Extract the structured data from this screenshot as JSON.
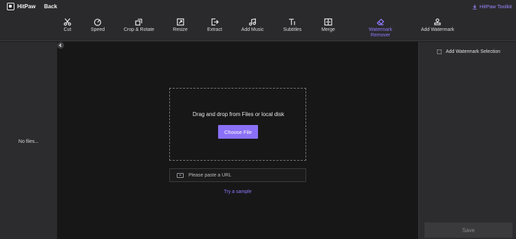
{
  "app": {
    "name": "HitPaw",
    "back_label": "Back",
    "toolkit_label": "HitPaw Toolkit"
  },
  "toolbar": {
    "tools": [
      {
        "label": "Cut",
        "icon": "scissors-icon"
      },
      {
        "label": "Speed",
        "icon": "speedometer-icon"
      },
      {
        "label": "Crop & Rotate",
        "icon": "crop-rotate-icon"
      },
      {
        "label": "Resize",
        "icon": "resize-icon"
      },
      {
        "label": "Extract",
        "icon": "extract-icon"
      },
      {
        "label": "Add Music",
        "icon": "music-note-icon"
      },
      {
        "label": "Subtitles",
        "icon": "text-icon"
      },
      {
        "label": "Merge",
        "icon": "merge-icon"
      },
      {
        "label": "Watermark\nRemover",
        "icon": "eraser-icon",
        "active": true
      },
      {
        "label": "Add Watermark",
        "icon": "stamp-icon"
      }
    ]
  },
  "left_panel": {
    "empty_text": "No files..."
  },
  "upload": {
    "drop_text": "Drag and drop from Files or local disk",
    "choose_label": "Choose File",
    "url_placeholder": "Please paste a URL",
    "sample_label": "Try a sample"
  },
  "right_panel": {
    "selection_label": "Add Watermark Selection",
    "save_label": "Save"
  },
  "colors": {
    "accent": "#8a70f7",
    "background": "#171718",
    "panel": "#2c2c2e"
  }
}
